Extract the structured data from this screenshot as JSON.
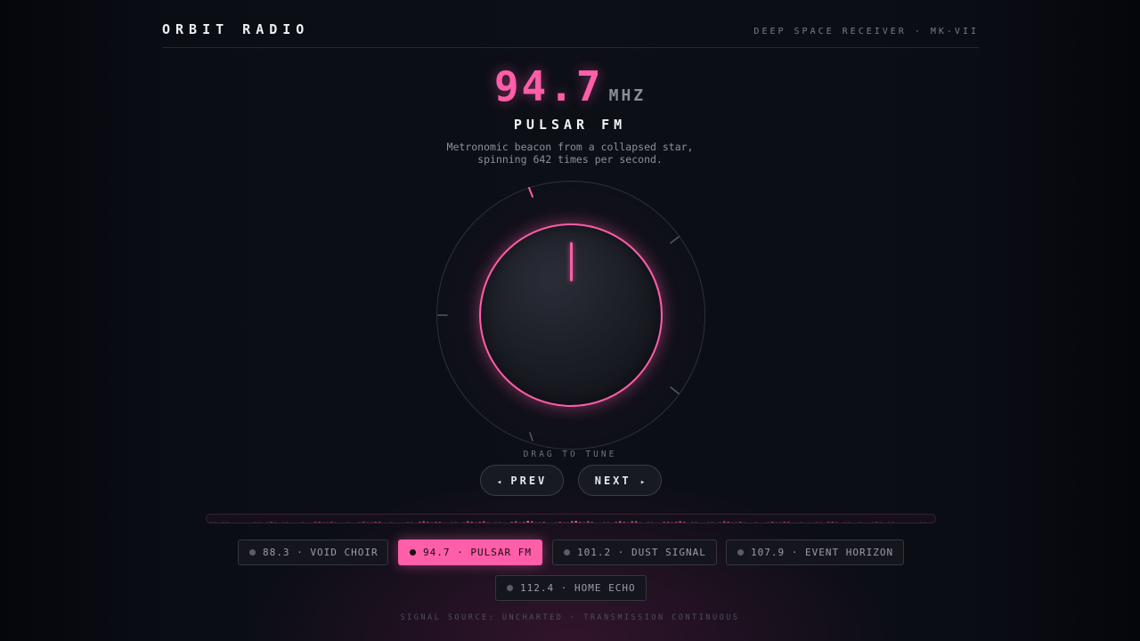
{
  "header": {
    "brand": "ORBIT RADIO",
    "subtitle": "DEEP SPACE RECEIVER · MK-VII"
  },
  "tuner": {
    "frequency": "94.7",
    "unit": "MHZ",
    "station": "PULSAR FM",
    "description_lines": [
      "Metronomic beacon from a collapsed star,",
      "spinning 642 times per second."
    ],
    "drag_hint": "DRAG TO TUNE"
  },
  "controls": {
    "prev": {
      "glyph": "◂",
      "label": "PREV"
    },
    "next": {
      "glyph": "▸",
      "label": "NEXT"
    }
  },
  "presets": [
    {
      "label": "88.3 · VOID CHOIR",
      "active": false
    },
    {
      "label": "94.7 · PULSAR FM",
      "active": true
    },
    {
      "label": "101.2 · DUST SIGNAL",
      "active": false
    },
    {
      "label": "107.9 · EVENT HORIZON",
      "active": false
    },
    {
      "label": "112.4 · HOME ECHO",
      "active": false
    }
  ],
  "footer": "SIGNAL SOURCE: UNCHARTED · TRANSMISSION CONTINUOUS",
  "colors": {
    "accent": "#ff5ea8",
    "background": "#0d0f17",
    "muted_text": "#8d8f9b"
  },
  "icons": {
    "prev": "triangle-left-icon",
    "next": "triangle-right-icon",
    "preset_dot": "dot-icon"
  }
}
